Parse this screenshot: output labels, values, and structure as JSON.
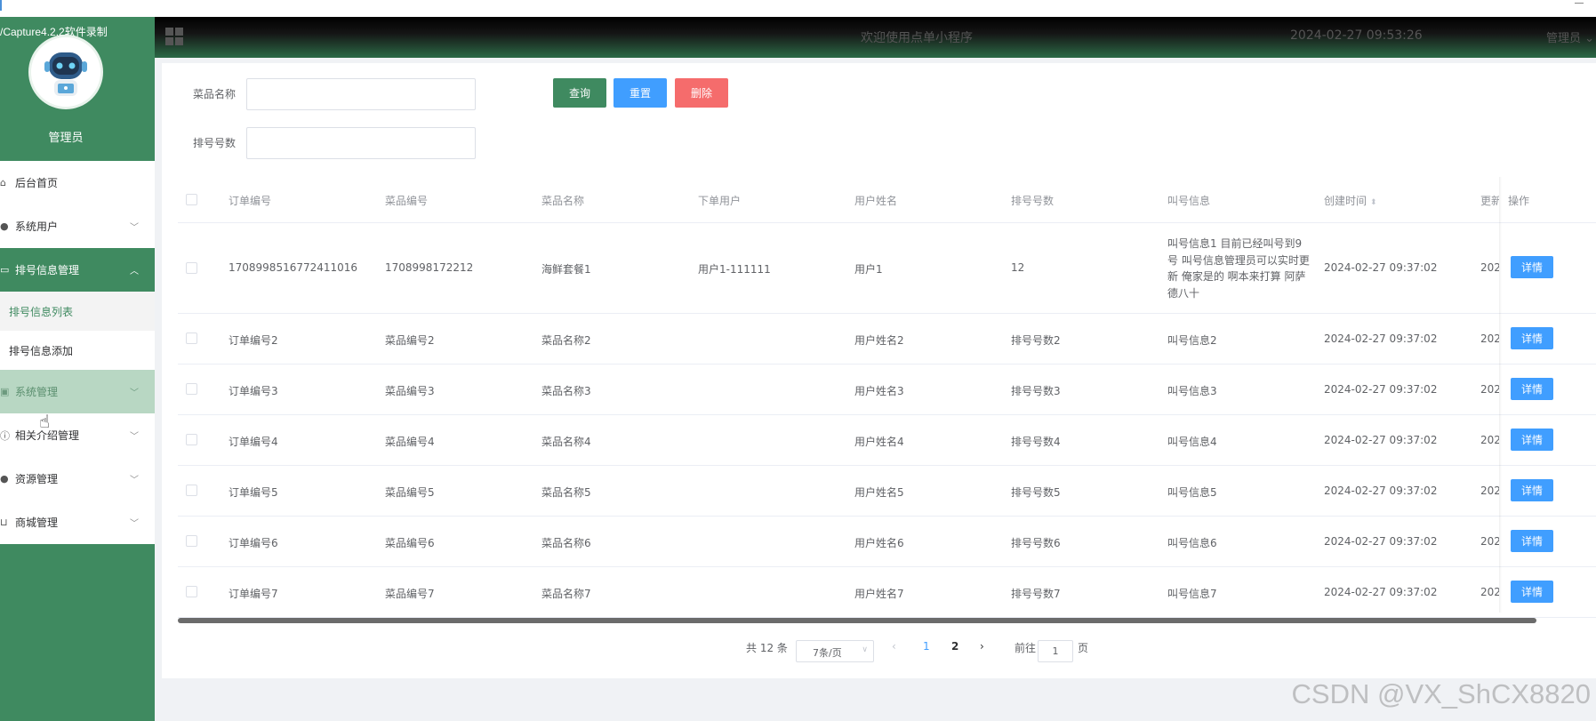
{
  "capture_label": "/Capture4.2.2软件录制",
  "sidebar": {
    "role": "管理员",
    "items": [
      {
        "label": "后台首页",
        "icon": "home-icon"
      },
      {
        "label": "系统用户",
        "icon": "user-icon"
      },
      {
        "label": "排号信息管理",
        "icon": "list-icon"
      },
      {
        "label": "排号信息列表"
      },
      {
        "label": "排号信息添加"
      },
      {
        "label": "系统管理",
        "icon": "settings-icon"
      },
      {
        "label": "相关介绍管理",
        "icon": "info-icon"
      },
      {
        "label": "资源管理",
        "icon": "resource-icon"
      },
      {
        "label": "商城管理",
        "icon": "shop-icon"
      }
    ]
  },
  "header": {
    "welcome": "欢迎使用点单小程序",
    "datetime": "2024-02-27 09:53:26",
    "user_menu": "管理员"
  },
  "search": {
    "dish_name_label": "菜品名称",
    "queue_number_label": "排号号数",
    "dish_name_value": "",
    "queue_number_value": "",
    "query_btn": "查询",
    "reset_btn": "重置",
    "delete_btn": "删除"
  },
  "table": {
    "headers": [
      "订单编号",
      "菜品编号",
      "菜品名称",
      "下单用户",
      "用户姓名",
      "排号号数",
      "叫号信息",
      "创建时间",
      "更新",
      "操作"
    ],
    "detail_label": "详情",
    "rows": [
      {
        "order_no": "1708998516772411016",
        "dish_no": "1708998172212",
        "dish_name": "海鲜套餐1",
        "order_user": "用户1-111111",
        "user_name": "用户1",
        "queue_no": "12",
        "call_info": "叫号信息1 目前已经叫号到9号 叫号信息管理员可以实时更新 俺家是的 啊本来打算 阿萨德八十",
        "created": "2024-02-27 09:37:02",
        "updated": "202"
      },
      {
        "order_no": "订单编号2",
        "dish_no": "菜品编号2",
        "dish_name": "菜品名称2",
        "order_user": "",
        "user_name": "用户姓名2",
        "queue_no": "排号号数2",
        "call_info": "叫号信息2",
        "created": "2024-02-27 09:37:02",
        "updated": "202"
      },
      {
        "order_no": "订单编号3",
        "dish_no": "菜品编号3",
        "dish_name": "菜品名称3",
        "order_user": "",
        "user_name": "用户姓名3",
        "queue_no": "排号号数3",
        "call_info": "叫号信息3",
        "created": "2024-02-27 09:37:02",
        "updated": "202"
      },
      {
        "order_no": "订单编号4",
        "dish_no": "菜品编号4",
        "dish_name": "菜品名称4",
        "order_user": "",
        "user_name": "用户姓名4",
        "queue_no": "排号号数4",
        "call_info": "叫号信息4",
        "created": "2024-02-27 09:37:02",
        "updated": "202"
      },
      {
        "order_no": "订单编号5",
        "dish_no": "菜品编号5",
        "dish_name": "菜品名称5",
        "order_user": "",
        "user_name": "用户姓名5",
        "queue_no": "排号号数5",
        "call_info": "叫号信息5",
        "created": "2024-02-27 09:37:02",
        "updated": "202"
      },
      {
        "order_no": "订单编号6",
        "dish_no": "菜品编号6",
        "dish_name": "菜品名称6",
        "order_user": "",
        "user_name": "用户姓名6",
        "queue_no": "排号号数6",
        "call_info": "叫号信息6",
        "created": "2024-02-27 09:37:02",
        "updated": "202"
      },
      {
        "order_no": "订单编号7",
        "dish_no": "菜品编号7",
        "dish_name": "菜品名称7",
        "order_user": "",
        "user_name": "用户姓名7",
        "queue_no": "排号号数7",
        "call_info": "叫号信息7",
        "created": "2024-02-27 09:37:02",
        "updated": "202"
      }
    ]
  },
  "pagination": {
    "total": "共 12 条",
    "page_size": "7条/页",
    "pages": [
      "1",
      "2"
    ],
    "current_page": "1",
    "goto_prefix": "前往",
    "goto_value": "1",
    "goto_suffix": "页"
  },
  "watermark": "CSDN @VX_ShCX8820",
  "colors": {
    "brand_green": "#3f8a60",
    "primary_blue": "#409eff",
    "danger_red": "#f56c6c"
  }
}
